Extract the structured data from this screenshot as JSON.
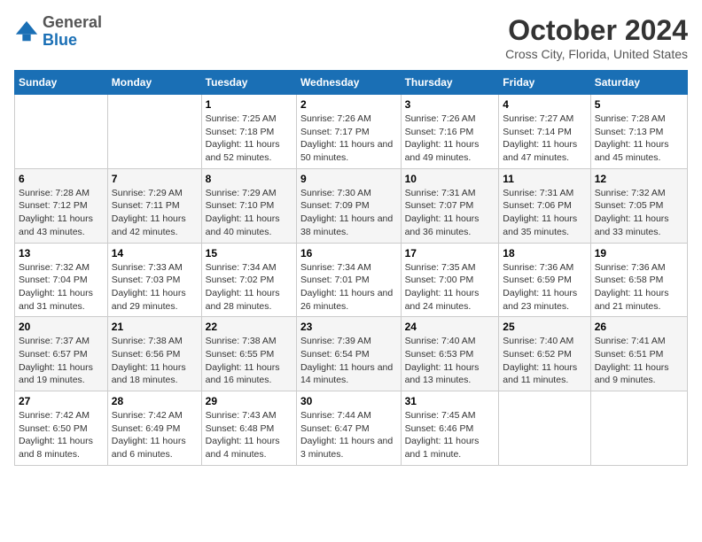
{
  "header": {
    "logo_line1": "General",
    "logo_line2": "Blue",
    "month_title": "October 2024",
    "location": "Cross City, Florida, United States"
  },
  "days_of_week": [
    "Sunday",
    "Monday",
    "Tuesday",
    "Wednesday",
    "Thursday",
    "Friday",
    "Saturday"
  ],
  "weeks": [
    [
      {
        "day": "",
        "sunrise": "",
        "sunset": "",
        "daylight": ""
      },
      {
        "day": "",
        "sunrise": "",
        "sunset": "",
        "daylight": ""
      },
      {
        "day": "1",
        "sunrise": "Sunrise: 7:25 AM",
        "sunset": "Sunset: 7:18 PM",
        "daylight": "Daylight: 11 hours and 52 minutes."
      },
      {
        "day": "2",
        "sunrise": "Sunrise: 7:26 AM",
        "sunset": "Sunset: 7:17 PM",
        "daylight": "Daylight: 11 hours and 50 minutes."
      },
      {
        "day": "3",
        "sunrise": "Sunrise: 7:26 AM",
        "sunset": "Sunset: 7:16 PM",
        "daylight": "Daylight: 11 hours and 49 minutes."
      },
      {
        "day": "4",
        "sunrise": "Sunrise: 7:27 AM",
        "sunset": "Sunset: 7:14 PM",
        "daylight": "Daylight: 11 hours and 47 minutes."
      },
      {
        "day": "5",
        "sunrise": "Sunrise: 7:28 AM",
        "sunset": "Sunset: 7:13 PM",
        "daylight": "Daylight: 11 hours and 45 minutes."
      }
    ],
    [
      {
        "day": "6",
        "sunrise": "Sunrise: 7:28 AM",
        "sunset": "Sunset: 7:12 PM",
        "daylight": "Daylight: 11 hours and 43 minutes."
      },
      {
        "day": "7",
        "sunrise": "Sunrise: 7:29 AM",
        "sunset": "Sunset: 7:11 PM",
        "daylight": "Daylight: 11 hours and 42 minutes."
      },
      {
        "day": "8",
        "sunrise": "Sunrise: 7:29 AM",
        "sunset": "Sunset: 7:10 PM",
        "daylight": "Daylight: 11 hours and 40 minutes."
      },
      {
        "day": "9",
        "sunrise": "Sunrise: 7:30 AM",
        "sunset": "Sunset: 7:09 PM",
        "daylight": "Daylight: 11 hours and 38 minutes."
      },
      {
        "day": "10",
        "sunrise": "Sunrise: 7:31 AM",
        "sunset": "Sunset: 7:07 PM",
        "daylight": "Daylight: 11 hours and 36 minutes."
      },
      {
        "day": "11",
        "sunrise": "Sunrise: 7:31 AM",
        "sunset": "Sunset: 7:06 PM",
        "daylight": "Daylight: 11 hours and 35 minutes."
      },
      {
        "day": "12",
        "sunrise": "Sunrise: 7:32 AM",
        "sunset": "Sunset: 7:05 PM",
        "daylight": "Daylight: 11 hours and 33 minutes."
      }
    ],
    [
      {
        "day": "13",
        "sunrise": "Sunrise: 7:32 AM",
        "sunset": "Sunset: 7:04 PM",
        "daylight": "Daylight: 11 hours and 31 minutes."
      },
      {
        "day": "14",
        "sunrise": "Sunrise: 7:33 AM",
        "sunset": "Sunset: 7:03 PM",
        "daylight": "Daylight: 11 hours and 29 minutes."
      },
      {
        "day": "15",
        "sunrise": "Sunrise: 7:34 AM",
        "sunset": "Sunset: 7:02 PM",
        "daylight": "Daylight: 11 hours and 28 minutes."
      },
      {
        "day": "16",
        "sunrise": "Sunrise: 7:34 AM",
        "sunset": "Sunset: 7:01 PM",
        "daylight": "Daylight: 11 hours and 26 minutes."
      },
      {
        "day": "17",
        "sunrise": "Sunrise: 7:35 AM",
        "sunset": "Sunset: 7:00 PM",
        "daylight": "Daylight: 11 hours and 24 minutes."
      },
      {
        "day": "18",
        "sunrise": "Sunrise: 7:36 AM",
        "sunset": "Sunset: 6:59 PM",
        "daylight": "Daylight: 11 hours and 23 minutes."
      },
      {
        "day": "19",
        "sunrise": "Sunrise: 7:36 AM",
        "sunset": "Sunset: 6:58 PM",
        "daylight": "Daylight: 11 hours and 21 minutes."
      }
    ],
    [
      {
        "day": "20",
        "sunrise": "Sunrise: 7:37 AM",
        "sunset": "Sunset: 6:57 PM",
        "daylight": "Daylight: 11 hours and 19 minutes."
      },
      {
        "day": "21",
        "sunrise": "Sunrise: 7:38 AM",
        "sunset": "Sunset: 6:56 PM",
        "daylight": "Daylight: 11 hours and 18 minutes."
      },
      {
        "day": "22",
        "sunrise": "Sunrise: 7:38 AM",
        "sunset": "Sunset: 6:55 PM",
        "daylight": "Daylight: 11 hours and 16 minutes."
      },
      {
        "day": "23",
        "sunrise": "Sunrise: 7:39 AM",
        "sunset": "Sunset: 6:54 PM",
        "daylight": "Daylight: 11 hours and 14 minutes."
      },
      {
        "day": "24",
        "sunrise": "Sunrise: 7:40 AM",
        "sunset": "Sunset: 6:53 PM",
        "daylight": "Daylight: 11 hours and 13 minutes."
      },
      {
        "day": "25",
        "sunrise": "Sunrise: 7:40 AM",
        "sunset": "Sunset: 6:52 PM",
        "daylight": "Daylight: 11 hours and 11 minutes."
      },
      {
        "day": "26",
        "sunrise": "Sunrise: 7:41 AM",
        "sunset": "Sunset: 6:51 PM",
        "daylight": "Daylight: 11 hours and 9 minutes."
      }
    ],
    [
      {
        "day": "27",
        "sunrise": "Sunrise: 7:42 AM",
        "sunset": "Sunset: 6:50 PM",
        "daylight": "Daylight: 11 hours and 8 minutes."
      },
      {
        "day": "28",
        "sunrise": "Sunrise: 7:42 AM",
        "sunset": "Sunset: 6:49 PM",
        "daylight": "Daylight: 11 hours and 6 minutes."
      },
      {
        "day": "29",
        "sunrise": "Sunrise: 7:43 AM",
        "sunset": "Sunset: 6:48 PM",
        "daylight": "Daylight: 11 hours and 4 minutes."
      },
      {
        "day": "30",
        "sunrise": "Sunrise: 7:44 AM",
        "sunset": "Sunset: 6:47 PM",
        "daylight": "Daylight: 11 hours and 3 minutes."
      },
      {
        "day": "31",
        "sunrise": "Sunrise: 7:45 AM",
        "sunset": "Sunset: 6:46 PM",
        "daylight": "Daylight: 11 hours and 1 minute."
      },
      {
        "day": "",
        "sunrise": "",
        "sunset": "",
        "daylight": ""
      },
      {
        "day": "",
        "sunrise": "",
        "sunset": "",
        "daylight": ""
      }
    ]
  ]
}
